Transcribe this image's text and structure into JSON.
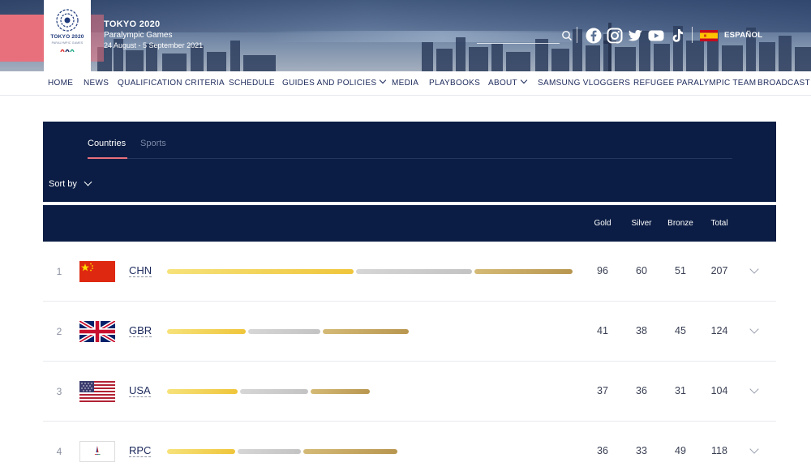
{
  "brand": {
    "logo_text": "TOKYO 2020",
    "logo_subtext": "PARALYMPIC GAMES",
    "title": "TOKYO 2020",
    "subtitle": "Paralympic Games",
    "dates": "24 August - 5 September 2021"
  },
  "header": {
    "language_label": "ESPAÑOL",
    "social_icons": [
      "facebook-icon",
      "instagram-icon",
      "twitter-icon",
      "youtube-icon",
      "tiktok-icon"
    ]
  },
  "nav": {
    "items": [
      {
        "label": "HOME"
      },
      {
        "label": "NEWS"
      },
      {
        "label": "QUALIFICATION CRITERIA"
      },
      {
        "label": "SCHEDULE"
      },
      {
        "label": "GUIDES AND POLICIES"
      },
      {
        "label": "MEDIA"
      },
      {
        "label": "PLAYBOOKS"
      },
      {
        "label": "ABOUT"
      },
      {
        "label": "SAMSUNG VLOGGERS"
      },
      {
        "label": "REFUGEE PARALYMPIC TEAM"
      },
      {
        "label": "BROADCAST"
      }
    ]
  },
  "medals": {
    "tabs": [
      {
        "label": "Countries"
      },
      {
        "label": "Sports"
      }
    ],
    "sort_label": "Sort by",
    "columns": {
      "gold": "Gold",
      "silver": "Silver",
      "bronze": "Bronze",
      "total": "Total"
    },
    "bar_colors": {
      "gold": "#efc53a",
      "silver": "#c8c8c8",
      "bronze": "#b8964f"
    },
    "rows": [
      {
        "rank": "1",
        "code": "CHN",
        "flag": "china-flag",
        "gold": 96,
        "silver": 60,
        "bronze": 51,
        "total": 207
      },
      {
        "rank": "2",
        "code": "GBR",
        "flag": "uk-flag",
        "gold": 41,
        "silver": 38,
        "bronze": 45,
        "total": 124
      },
      {
        "rank": "3",
        "code": "USA",
        "flag": "usa-flag",
        "gold": 37,
        "silver": 36,
        "bronze": 31,
        "total": 104
      },
      {
        "rank": "4",
        "code": "RPC",
        "flag": "rpc-flag",
        "gold": 36,
        "silver": 33,
        "bronze": 49,
        "total": 118
      }
    ]
  },
  "colors": {
    "navy": "#0b1d44",
    "accent_pink": "#e8707c",
    "nav_text": "#1d2a5c"
  }
}
